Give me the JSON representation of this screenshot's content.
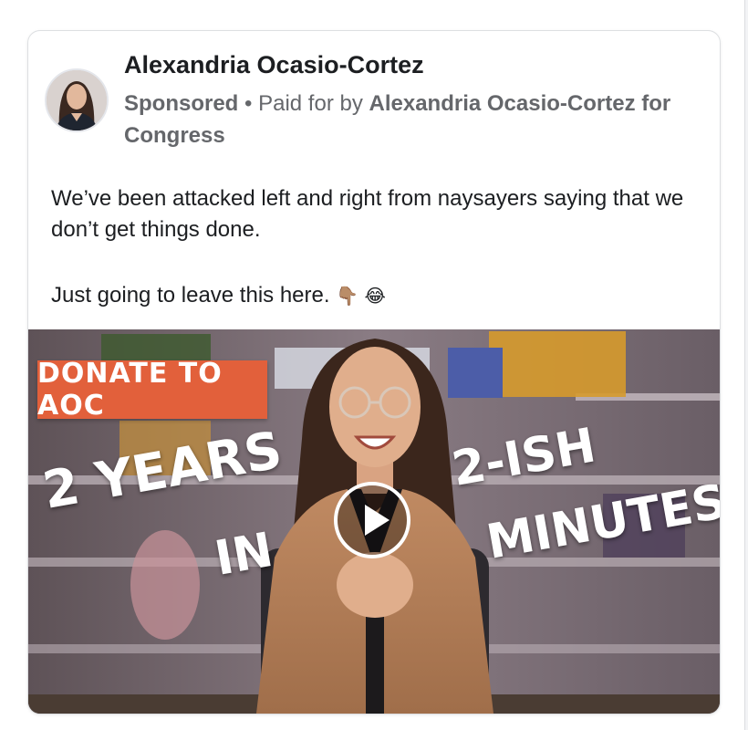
{
  "post": {
    "author": "Alexandria Ocasio-Cortez",
    "sponsored_label": "Sponsored",
    "separator": " • ",
    "paid_for_prefix": "Paid for by ",
    "paid_for_by": "Alexandria Ocasio-Cortez for Congress",
    "text_line_1": "We’ve been attacked left and right from naysayers saying that we don’t get things done.",
    "text_line_2": "Just going to leave this here.",
    "text_emojis": "👇🏽 😂"
  },
  "video": {
    "badge": "DONATE TO AOC",
    "caption_left_1": "2 YEARS",
    "caption_left_2": "IN",
    "caption_right_1": "2-ISH",
    "caption_right_2": "MINUTES",
    "play_icon": "play-icon"
  },
  "colors": {
    "badge": "#e2603b",
    "meta_text": "#65676b",
    "primary_text": "#1c1e21"
  }
}
